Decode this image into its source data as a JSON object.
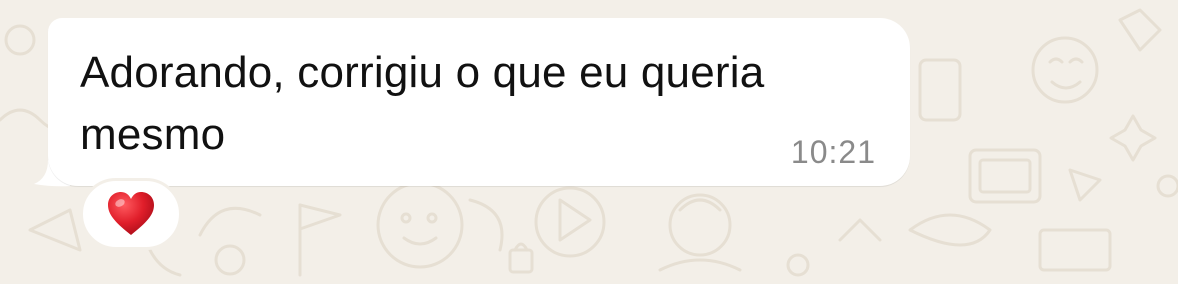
{
  "message": {
    "text": "Adorando, corrigiu o que eu queria mesmo",
    "time": "10:21",
    "reaction": {
      "emoji": "❤️",
      "icon": "red-heart-icon",
      "color": "#e01e2a"
    }
  },
  "theme": {
    "wallpaper_color": "#f3efe8",
    "bubble_color": "#ffffff",
    "text_color": "#111111",
    "time_color": "#8a8a8a"
  }
}
